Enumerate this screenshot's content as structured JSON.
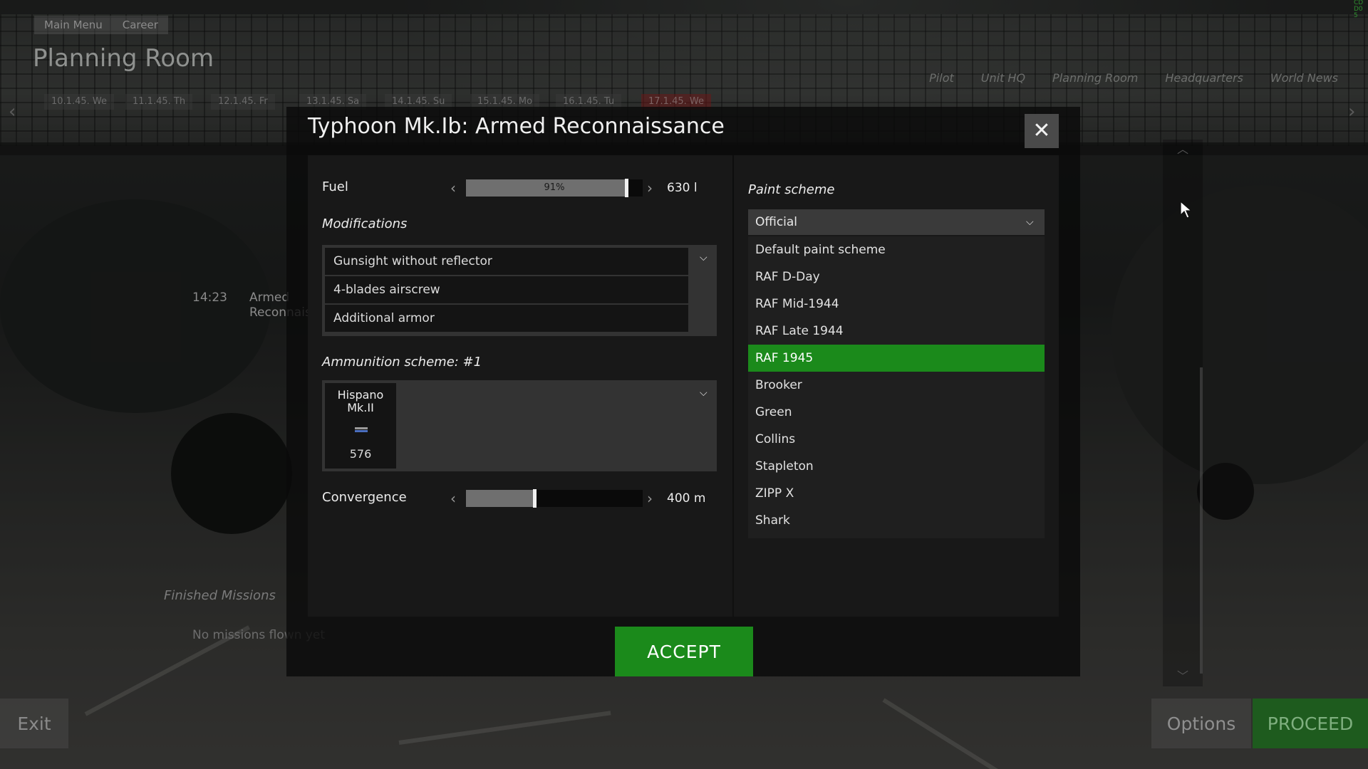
{
  "background": {
    "breadcrumb": [
      "Main Menu",
      "Career"
    ],
    "page_title": "Planning Room",
    "nav": [
      "Pilot",
      "Unit HQ",
      "Planning Room",
      "Headquarters",
      "World News"
    ],
    "corner_text": "CDD05",
    "dates": [
      "10.1.45. We",
      "11.1.45. Th",
      "12.1.45. Fr",
      "13.1.45. Sa",
      "14.1.45. Su",
      "15.1.45. Mo",
      "16.1.45. Tu",
      "17.1.45. We"
    ],
    "mission": {
      "time": "14:23",
      "name": "Armed Reconnaissance"
    },
    "finished_missions_label": "Finished Missions",
    "no_missions_text": "No missions flown yet",
    "exit_label": "Exit",
    "options_label": "Options",
    "proceed_label": "PROCEED"
  },
  "dialog": {
    "title": "Typhoon Mk.Ib: Armed Reconnaissance",
    "fuel": {
      "label": "Fuel",
      "percent_text": "91%",
      "fraction": 0.91,
      "value_text": "630 l"
    },
    "modifications": {
      "label": "Modifications",
      "items": [
        "Gunsight without reflector",
        "4-blades airscrew",
        "Additional armor"
      ]
    },
    "ammunition": {
      "label": "Ammunition scheme: #1",
      "weapon": "Hispano Mk.II",
      "count": "576"
    },
    "convergence": {
      "label": "Convergence",
      "fraction": 0.39,
      "value_text": "400 m"
    },
    "paint_scheme": {
      "label": "Paint scheme",
      "selected_value": "Official",
      "options": [
        "Default paint scheme",
        "RAF D-Day",
        "RAF Mid-1944",
        "RAF Late 1944",
        "RAF 1945",
        "Brooker",
        "Green",
        "Collins",
        "Stapleton",
        "ZIPP X",
        "Shark"
      ],
      "highlighted": "RAF 1945"
    },
    "accept_label": "ACCEPT"
  },
  "colors": {
    "accent_green": "#1b8a1b",
    "dialog_bg": "#181818",
    "close_button_bg": "#4a4a4a"
  },
  "icons": {
    "close": "close-icon",
    "dropdown": "chevron-down-icon",
    "slider_left": "chevron-left-icon",
    "slider_right": "chevron-right-icon",
    "ammo": "bullets-icon",
    "cursor": "mouse-cursor-icon"
  }
}
